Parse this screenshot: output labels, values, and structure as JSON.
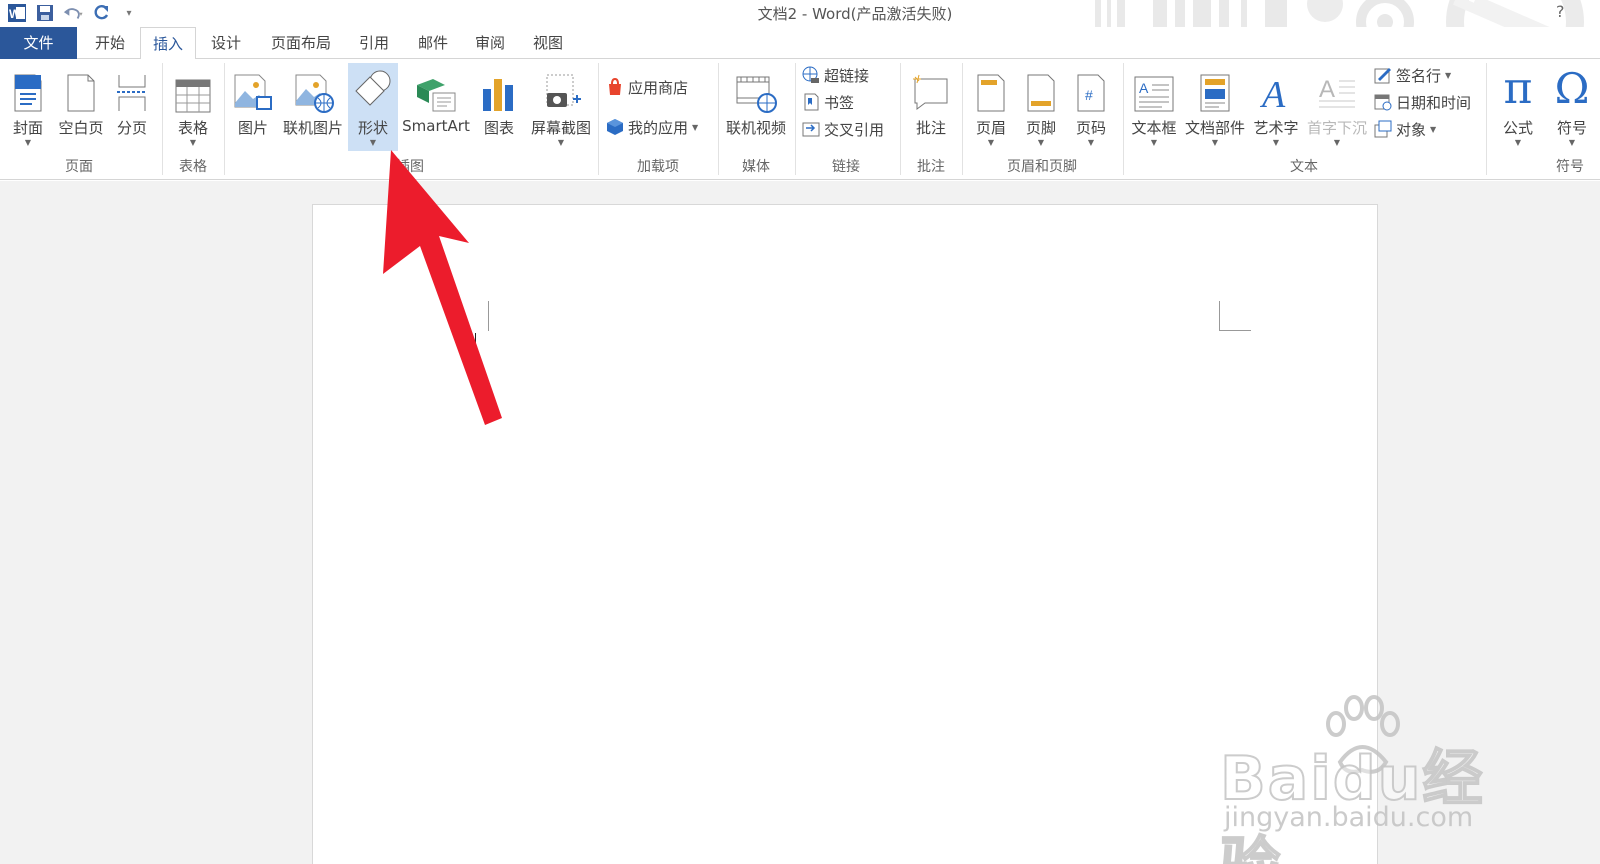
{
  "window": {
    "title": "文档2 - Word(产品激活失败)",
    "help": "?"
  },
  "qat": [
    "word-logo-icon",
    "save-icon",
    "undo-icon",
    "redo-icon",
    "customize-qat-icon"
  ],
  "tabs": {
    "file": "文件",
    "home": "开始",
    "insert": "插入",
    "design": "设计",
    "layout": "页面布局",
    "references": "引用",
    "mailings": "邮件",
    "review": "审阅",
    "view": "视图",
    "active": "插入"
  },
  "ribbon": {
    "pages": {
      "cover": "封面",
      "blank": "空白页",
      "break": "分页",
      "group": "页面"
    },
    "tables": {
      "table": "表格",
      "group": "表格"
    },
    "illustrations": {
      "pictures": "图片",
      "online_pictures": "联机图片",
      "shapes": "形状",
      "smartart": "SmartArt",
      "chart": "图表",
      "screenshot": "屏幕截图",
      "group": "插图"
    },
    "addins": {
      "store": "应用商店",
      "my_apps": "我的应用",
      "group": "加载项"
    },
    "media": {
      "online_video": "联机视频",
      "group": "媒体"
    },
    "links": {
      "hyperlink": "超链接",
      "bookmark": "书签",
      "cross_ref": "交叉引用",
      "group": "链接"
    },
    "comments": {
      "comment": "批注",
      "group": "批注"
    },
    "header_footer": {
      "header": "页眉",
      "footer": "页脚",
      "page_number": "页码",
      "group": "页眉和页脚"
    },
    "text": {
      "textbox": "文本框",
      "quick_parts": "文档部件",
      "wordart": "艺术字",
      "dropcap": "首字下沉",
      "signature": "签名行",
      "datetime": "日期和时间",
      "object": "对象",
      "group": "文本"
    },
    "symbols": {
      "equation": "公式",
      "symbol": "符号",
      "group": "符号"
    }
  },
  "colors": {
    "brand": "#2b579a",
    "arrow": "#ec1c2c",
    "selected": "#cde0f5"
  },
  "watermark": {
    "main": "Baidu经验",
    "sub": "jingyan.baidu.com"
  }
}
